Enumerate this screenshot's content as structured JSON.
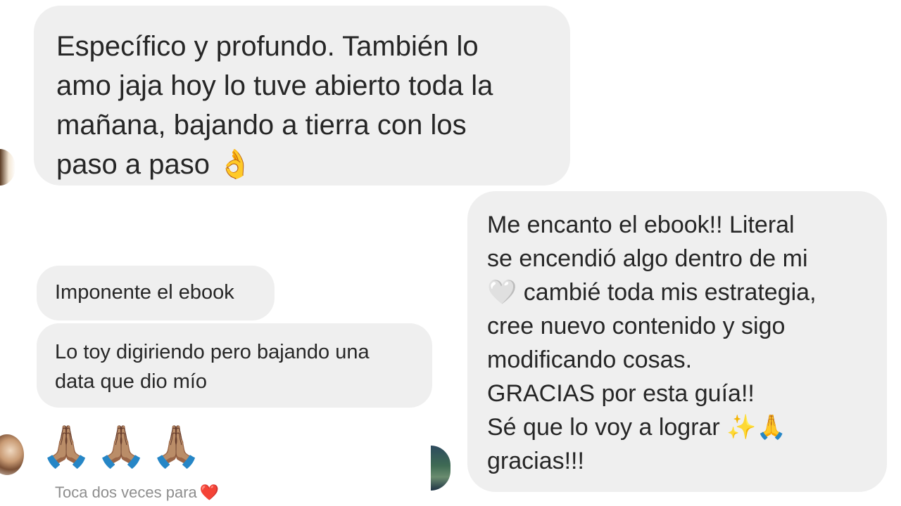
{
  "conversation": {
    "messages": [
      {
        "from": "other",
        "text": "Específico y profundo. También lo\namo jaja hoy lo tuve abierto toda la\nmañana, bajando a tierra con los\npaso a paso 👌"
      },
      {
        "from": "other",
        "text": "Me encanto el ebook!! Literal\nse encendió algo dentro de mi\n🤍 cambié toda mis estrategia,\ncree nuevo contenido y sigo\nmodificando cosas.\nGRACIAS por esta guía!!\nSé que lo voy a lograr ✨🙏\ngracias!!!"
      },
      {
        "from": "other",
        "text": "Imponente el ebook"
      },
      {
        "from": "other",
        "text": "Lo toy digiriendo pero bajando una\ndata que dio mío"
      }
    ],
    "reaction": {
      "emoji": "🙏🏽🙏🏽🙏🏽"
    },
    "tap_hint": {
      "text": "Toca dos veces para",
      "emoji": "❤️"
    },
    "avatars": [
      "avatar-photo",
      "avatar-photo",
      "avatar-photo"
    ]
  }
}
